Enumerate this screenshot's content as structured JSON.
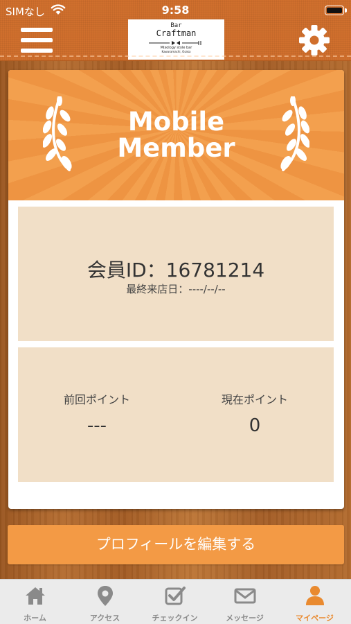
{
  "status_bar": {
    "carrier": "SIMなし",
    "time": "9:58",
    "wifi_icon": "wifi-icon",
    "battery_icon": "battery-icon"
  },
  "header": {
    "menu_icon": "hamburger-menu-icon",
    "settings_icon": "gear-icon",
    "logo": {
      "line1": "Bar",
      "line2": "Craftman",
      "tagline": "Mixology style bar",
      "sub": "Kawaramachi, Osaka"
    }
  },
  "banner": {
    "title_line1": "Mobile",
    "title_line2": "Member",
    "laurel_icon": "laurel-icon"
  },
  "member": {
    "id_text": "会員ID：16781214",
    "last_visit": "最終来店日：----/--/--"
  },
  "points": {
    "previous_label": "前回ポイント",
    "previous_value": "---",
    "current_label": "現在ポイント",
    "current_value": "0"
  },
  "edit_profile_label": "プロフィールを編集する",
  "colors": {
    "accent": "#f39a45",
    "header": "#d06f2d",
    "panel": "#f1dfc7",
    "tab_active": "#e98a2f",
    "tab_inactive": "#8a8a8a"
  },
  "tabs": [
    {
      "label": "ホーム",
      "icon": "home-icon",
      "active": false
    },
    {
      "label": "アクセス",
      "icon": "map-pin-icon",
      "active": false
    },
    {
      "label": "チェックイン",
      "icon": "checkbox-icon",
      "active": false
    },
    {
      "label": "メッセージ",
      "icon": "mail-icon",
      "active": false
    },
    {
      "label": "マイページ",
      "icon": "person-icon",
      "active": true
    }
  ]
}
